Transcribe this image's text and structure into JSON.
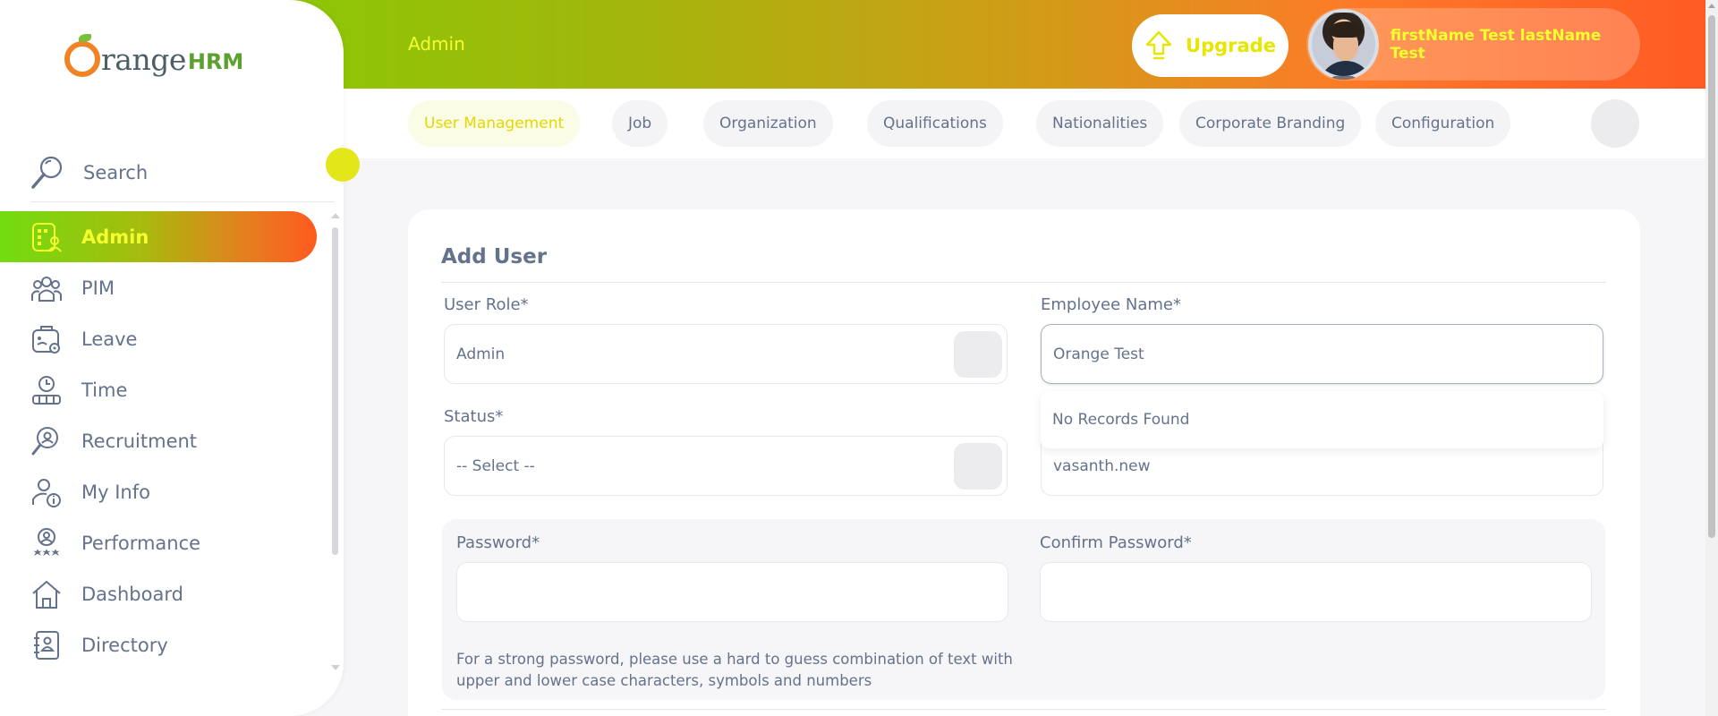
{
  "header": {
    "title": "Admin",
    "upgrade_label": "Upgrade",
    "user_name": "firstName Test lastName Test"
  },
  "logo": {
    "text": "range",
    "suffix": "HRM"
  },
  "tabs": [
    {
      "label": "User Management",
      "active": true
    },
    {
      "label": "Job"
    },
    {
      "label": "Organization"
    },
    {
      "label": "Qualifications"
    },
    {
      "label": "Nationalities"
    },
    {
      "label": "Corporate Branding"
    },
    {
      "label": "Configuration"
    }
  ],
  "sidebar": {
    "search_label": "Search",
    "items": [
      {
        "label": "Admin",
        "icon": "admin-icon",
        "active": true
      },
      {
        "label": "PIM",
        "icon": "pim-icon"
      },
      {
        "label": "Leave",
        "icon": "leave-icon"
      },
      {
        "label": "Time",
        "icon": "time-icon"
      },
      {
        "label": "Recruitment",
        "icon": "recruitment-icon"
      },
      {
        "label": "My Info",
        "icon": "my-info-icon"
      },
      {
        "label": "Performance",
        "icon": "performance-icon"
      },
      {
        "label": "Dashboard",
        "icon": "dashboard-icon"
      },
      {
        "label": "Directory",
        "icon": "directory-icon"
      }
    ]
  },
  "form": {
    "title": "Add User",
    "user_role": {
      "label": "User Role*",
      "value": "Admin"
    },
    "employee_name": {
      "label": "Employee Name*",
      "value": "Orange Test"
    },
    "status": {
      "label": "Status*",
      "value": "-- Select --"
    },
    "username": {
      "value": "vasanth.new"
    },
    "autocomplete_message": "No Records Found",
    "password": {
      "label": "Password*",
      "value": ""
    },
    "confirm_password": {
      "label": "Confirm Password*",
      "value": ""
    },
    "password_hint": "For a strong password, please use a hard to guess combination of text with upper and lower case characters, symbols and numbers"
  },
  "colors": {
    "accent_yellow": "#f4ff2d",
    "brand_green": "#7bd400",
    "brand_orange": "#ff5a24",
    "text": "#64728c"
  }
}
